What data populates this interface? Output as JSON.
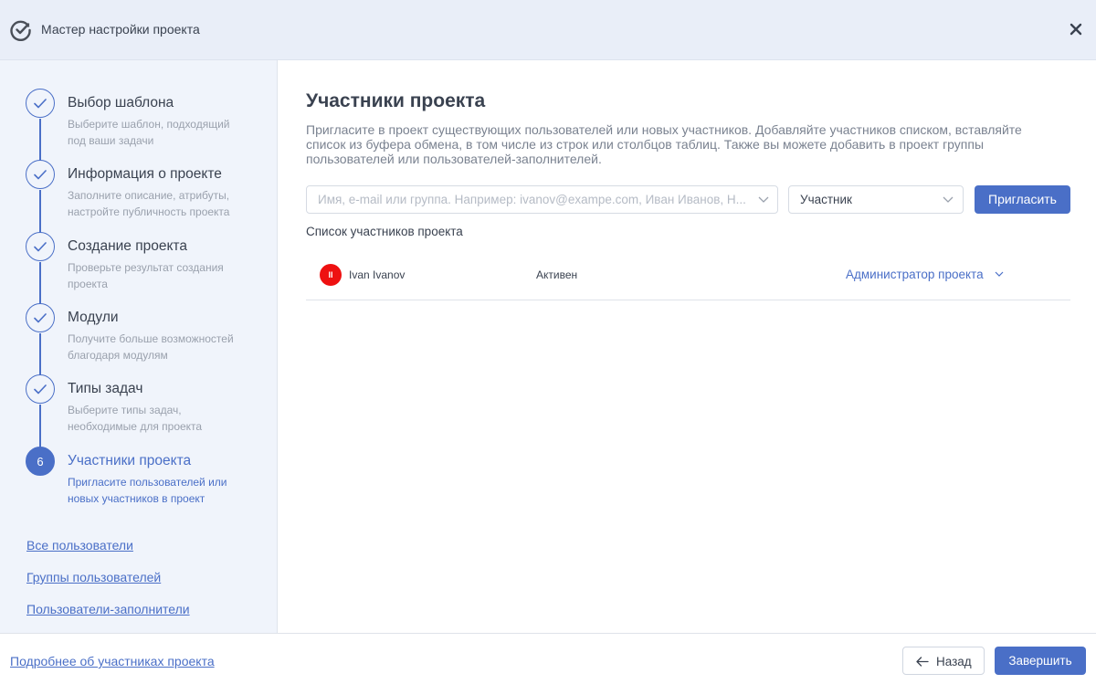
{
  "header": {
    "title": "Мастер настройки проекта",
    "logo_icon": "check-circle-icon",
    "close_icon": "close-icon"
  },
  "steps": [
    {
      "title": "Выбор шаблона",
      "desc": "Выберите шаблон, подходящий под ваши задачи",
      "state": "done"
    },
    {
      "title": "Информация о проекте",
      "desc": "Заполните описание, атрибуты, настройте публичность проекта",
      "state": "done"
    },
    {
      "title": "Создание проекта",
      "desc": "Проверьте результат создания проекта",
      "state": "done"
    },
    {
      "title": "Модули",
      "desc": "Получите больше возможностей благодаря модулям",
      "state": "done"
    },
    {
      "title": "Типы задач",
      "desc": "Выберите типы задач, необходимые для проекта",
      "state": "done"
    },
    {
      "title": "Участники проекта",
      "desc": "Пригласите пользователей или новых участников в проект",
      "state": "active",
      "number": "6"
    }
  ],
  "sidebar_links": [
    "Все пользователи",
    "Группы пользователей",
    "Пользователи-заполнители"
  ],
  "main": {
    "title": "Участники проекта",
    "intro": "Пригласите в проект существующих пользователей или новых участников. Добавляйте участников списком, вставляйте список из буфера обмена, в том числе из строк или столбцов таблиц. Также вы можете добавить в проект группы пользователей или пользователей-заполнителей.",
    "search_placeholder": "Имя, e-mail или группа. Например: ivanov@exampe.com, Иван Иванов, Н...",
    "role_value": "Участник",
    "invite_label": "Пригласить",
    "list_title": "Список участников проекта",
    "members": [
      {
        "initials": "II",
        "name": "Ivan Ivanov",
        "status": "Активен",
        "role": "Администратор проекта",
        "avatar_color": "#ee1111"
      }
    ]
  },
  "footer": {
    "link": "Подробнее об участниках проекта",
    "back_label": "Назад",
    "finish_label": "Завершить"
  },
  "colors": {
    "accent": "#4a6fc7",
    "header_bg": "#e9eef8",
    "sidebar_bg": "#f0f4fb"
  }
}
